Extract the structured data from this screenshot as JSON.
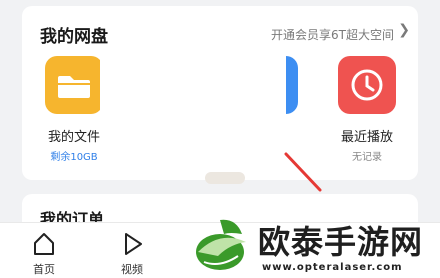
{
  "netdisk": {
    "title": "我的网盘",
    "promo": "开通会员享6T超大空间",
    "chevron": "❯",
    "tiles": [
      {
        "label": "我的文件",
        "sub": "剩余10GB",
        "sub_color": "#2f7fe8",
        "icon": "folder-icon"
      },
      {
        "label": "",
        "sub": "",
        "icon": "blue-app-icon"
      },
      {
        "label": "",
        "sub": "",
        "icon": "hourglass-icon"
      },
      {
        "label": "最近播放",
        "sub": "无记录",
        "sub_color": "#8a8a8a",
        "icon": "clock-icon"
      }
    ]
  },
  "orders": {
    "title": "我的订单"
  },
  "tabbar": {
    "home_label": "首页",
    "video_label": "视频"
  },
  "watermark": {
    "text": "欧泰手游网",
    "url": "www.opteralaser.com"
  },
  "colors": {
    "files_tile": "#f6b52e",
    "blue_tile": "#3d8ef2",
    "recent_tile": "#ef5350",
    "arrow": "#e53935",
    "watermark_green": "#3a9a2a"
  }
}
